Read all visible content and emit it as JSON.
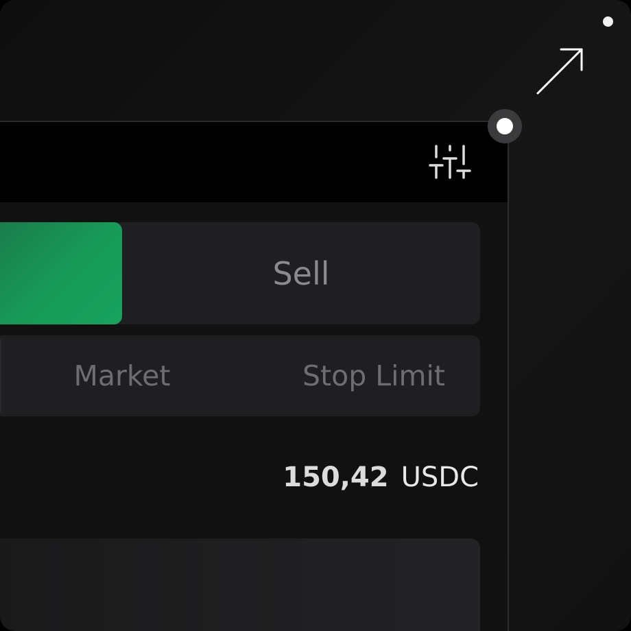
{
  "trade_panel": {
    "side_tabs": {
      "buy_label": "",
      "sell_label": "Sell",
      "active": "buy",
      "buy_color": "#179a58"
    },
    "order_types": {
      "items": [
        "Market",
        "Stop Limit"
      ]
    },
    "balance": {
      "amount": "150,42",
      "unit": "USDC"
    }
  },
  "icons": {
    "header_settings": "sliders-icon",
    "corner_expand": "arrow-up-right-icon"
  }
}
